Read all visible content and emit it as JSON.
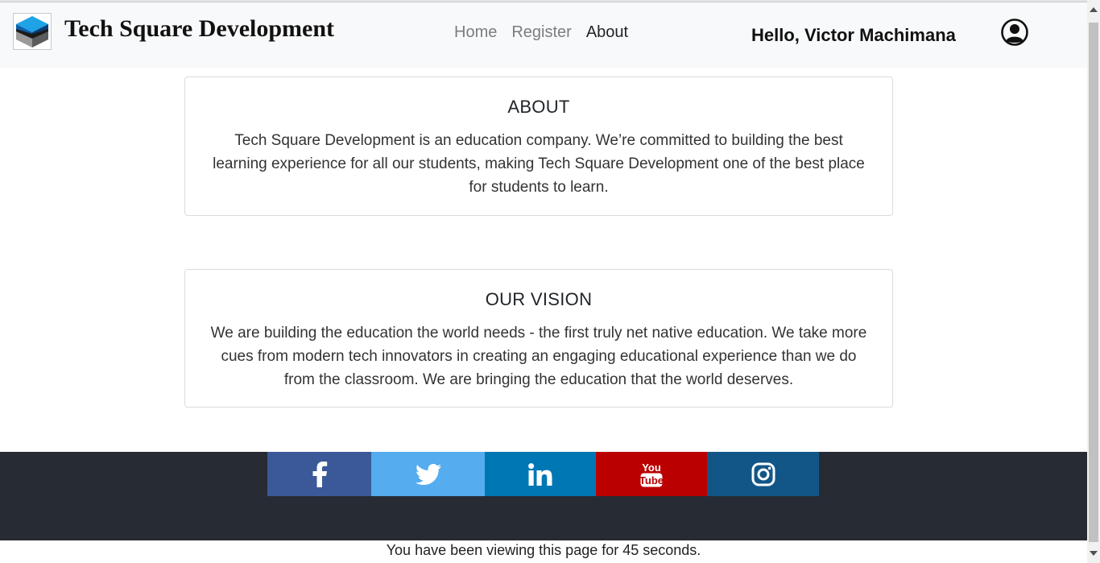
{
  "navbar": {
    "brand_title": "Tech Square Development",
    "links": [
      {
        "label": "Home"
      },
      {
        "label": "Register"
      },
      {
        "label": "About"
      }
    ],
    "greeting": "Hello, Victor Machimana",
    "user_icon": "user-circle-icon"
  },
  "about": {
    "title": "ABOUT",
    "text": "Tech Square Development is an education company. We’re committed to building the best learning experience for all our students, making Tech Square Development one of the best place for students to learn."
  },
  "vision": {
    "title": "OUR VISION",
    "text": "We are building the education the world needs - the first truly net native education. We take more cues from modern tech innovators in creating an engaging educational experience than we do from the classroom. We are bringing the education that the world deserves."
  },
  "footer": {
    "social": [
      {
        "icon": "facebook-icon",
        "color": "#3b5998"
      },
      {
        "icon": "twitter-icon",
        "color": "#55acee"
      },
      {
        "icon": "linkedin-icon",
        "color": "#0077b5"
      },
      {
        "icon": "youtube-icon",
        "color": "#bb0000",
        "top": "You",
        "bottom": "Tube"
      },
      {
        "icon": "instagram-icon",
        "color": "#125688"
      }
    ]
  },
  "timer_text": "You have been viewing this page for 45 seconds."
}
